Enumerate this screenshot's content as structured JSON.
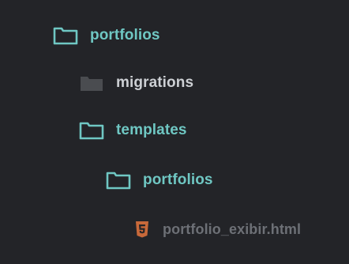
{
  "colors": {
    "background": "#232428",
    "folder_open_accent": "#6fc7c3",
    "folder_closed_fill": "#4a4c50",
    "html_icon": "#c8693a",
    "file_text": "#6d7076",
    "grey_text": "#cdd0d4"
  },
  "tree": {
    "items": [
      {
        "label": "portfolios",
        "icon": "folder-outline-icon",
        "kind": "folder"
      },
      {
        "label": "migrations",
        "icon": "folder-filled-icon",
        "kind": "folder"
      },
      {
        "label": "templates",
        "icon": "folder-outline-icon",
        "kind": "folder"
      },
      {
        "label": "portfolios",
        "icon": "folder-outline-icon",
        "kind": "folder"
      },
      {
        "label": "portfolio_exibir.html",
        "icon": "html5-file-icon",
        "kind": "file"
      }
    ]
  }
}
